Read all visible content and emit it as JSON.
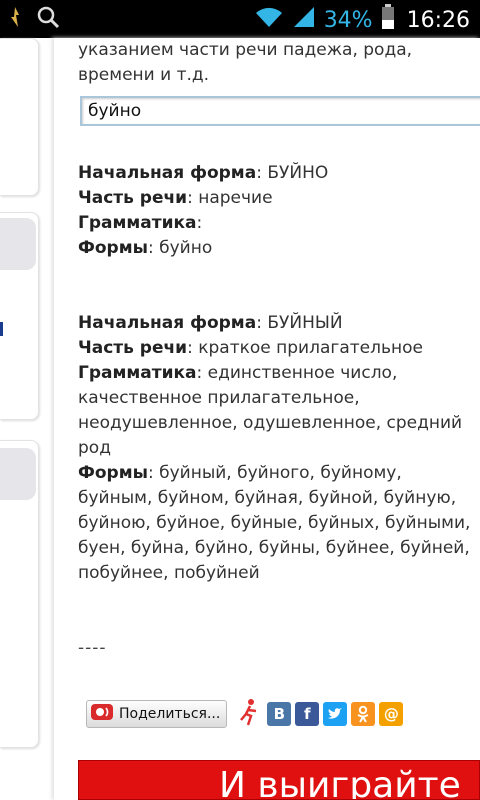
{
  "status": {
    "battery": "34%",
    "time": "16:26"
  },
  "intro_text": "указанием части речи падежа, рода, времени и т.д.",
  "search": {
    "value": "буйно"
  },
  "entries": [
    {
      "form_label": "Начальная форма",
      "form_value": "БУЙНО",
      "pos_label": "Часть речи",
      "pos_value": "наречие",
      "gram_label": "Грамматика",
      "gram_value": "",
      "forms_label": "Формы",
      "forms_value": "буйно"
    },
    {
      "form_label": "Начальная форма",
      "form_value": "БУЙНЫЙ",
      "pos_label": "Часть речи",
      "pos_value": "краткое прилагательное",
      "gram_label": "Грамматика",
      "gram_value": "единственное число, качественное прилагательное, неодушевленное, одушевленное, средний род",
      "forms_label": "Формы",
      "forms_value": "буйный, буйного, буйному, буйным, буйном, буйная, буйной, буйную, буйною, буйное, буйные, буйных, буйными, буен, буйна, буйно, буйны, буйнее, буйней, побуйнее, побуйней"
    }
  ],
  "separator": "----",
  "share": {
    "button_label": "Поделиться...",
    "icons": [
      "vkontakte-icon",
      "facebook-icon",
      "twitter-icon",
      "odnoklassniki-icon",
      "mailru-icon"
    ],
    "colors": {
      "vk": "#4a76a8",
      "facebook": "#3b5998",
      "twitter": "#1da1f2",
      "ok": "#f7931e",
      "mail": "#f4a100"
    }
  },
  "banner": {
    "text": "И выиграйте",
    "color": "#e01010"
  }
}
